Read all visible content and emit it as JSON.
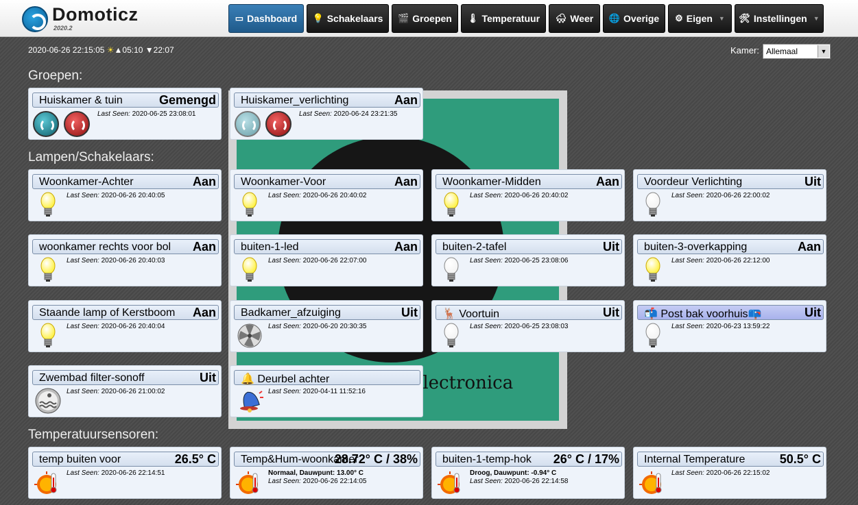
{
  "app": {
    "name": "Domoticz",
    "version": "2020.2"
  },
  "nav": [
    {
      "label": "Dashboard",
      "icon": "dashboard-icon",
      "active": true
    },
    {
      "label": "Schakelaars",
      "icon": "bulb-icon"
    },
    {
      "label": "Groepen",
      "icon": "groups-icon"
    },
    {
      "label": "Temperatuur",
      "icon": "thermometer-icon"
    },
    {
      "label": "Weer",
      "icon": "weather-icon"
    },
    {
      "label": "Overige",
      "icon": "utility-icon"
    },
    {
      "label": "Eigen",
      "icon": "gear-icon",
      "dropdown": true
    },
    {
      "label": "Instellingen",
      "icon": "tools-icon",
      "dropdown": true
    }
  ],
  "header": {
    "datetime": "2020-06-26 22:15:05",
    "sunrise": "▲05:10",
    "sunset": "▼22:07",
    "room_label": "Kamer:",
    "room_value": "Allemaal"
  },
  "sections": {
    "groups": "Groepen:",
    "switches": "Lampen/Schakelaars:",
    "temps": "Temperatuursensoren:"
  },
  "groups": [
    {
      "name": "Huiskamer & tuin",
      "status": "Gemengd",
      "seen": "2020-06-25 23:08:01"
    },
    {
      "name": "Huiskamer_verlichting",
      "status": "Aan",
      "seen": "2020-06-24 23:21:35"
    }
  ],
  "switches": [
    {
      "name": "Woonkamer-Achter",
      "status": "Aan",
      "seen": "2020-06-26 20:40:05",
      "icon": "bulb-on-icon"
    },
    {
      "name": "Woonkamer-Voor",
      "status": "Aan",
      "seen": "2020-06-26 20:40:02",
      "icon": "bulb-on-icon"
    },
    {
      "name": "Woonkamer-Midden",
      "status": "Aan",
      "seen": "2020-06-26 20:40:02",
      "icon": "bulb-on-icon"
    },
    {
      "name": "Voordeur Verlichting",
      "status": "Uit",
      "seen": "2020-06-26 22:00:02",
      "icon": "bulb-off-icon"
    },
    {
      "name": "woonkamer rechts voor bol",
      "status": "Aan",
      "seen": "2020-06-26 20:40:03",
      "icon": "bulb-on-icon"
    },
    {
      "name": "buiten-1-led",
      "status": "Aan",
      "seen": "2020-06-26 22:07:00",
      "icon": "bulb-on-icon"
    },
    {
      "name": "buiten-2-tafel",
      "status": "Uit",
      "seen": "2020-06-25 23:08:06",
      "icon": "bulb-off-icon"
    },
    {
      "name": "buiten-3-overkapping",
      "status": "Aan",
      "seen": "2020-06-26 22:12:00",
      "icon": "bulb-on-icon"
    },
    {
      "name": "Staande lamp of Kerstboom",
      "status": "Aan",
      "seen": "2020-06-26 20:40:04",
      "icon": "bulb-on-icon"
    },
    {
      "name": "Badkamer_afzuiging",
      "status": "Uit",
      "seen": "2020-06-20 20:30:35",
      "icon": "fan-icon"
    },
    {
      "name": "Voortuin",
      "status": "Uit",
      "seen": "2020-06-25 23:08:03",
      "icon": "bulb-off-icon",
      "prefix": "🦌"
    },
    {
      "name": "Post bak voorhuis",
      "status": "Uit",
      "seen": "2020-06-23 13:59:22",
      "icon": "bulb-off-icon",
      "prefix": "📬",
      "suffix": "📪",
      "highlight": true
    },
    {
      "name": "Zwembad filter-sonoff",
      "status": "Uit",
      "seen": "2020-06-26 21:00:02",
      "icon": "pool-icon"
    },
    {
      "name": "Deurbel achter",
      "status": "",
      "seen": "2020-04-11 11:52:16",
      "icon": "bell-icon",
      "prefix": "🔔"
    }
  ],
  "temps": [
    {
      "name": "temp buiten voor",
      "status": "26.5° C",
      "seen": "2020-06-26 22:14:51",
      "extra": ""
    },
    {
      "name": "Temp&Hum-woonkamer",
      "status": "28.72° C / 38%",
      "seen": "2020-06-26 22:14:05",
      "extra": "Normaal, Dauwpunt: 13.00° C"
    },
    {
      "name": "buiten-1-temp-hok",
      "status": "26° C / 17%",
      "seen": "2020-06-26 22:14:58",
      "extra": "Droog, Dauwpunt: -0.94° C"
    },
    {
      "name": "Internal Temperature",
      "status": "50.5° C",
      "seen": "2020-06-26 22:15:02",
      "extra": ""
    }
  ],
  "last_seen_label": "Last Seen:"
}
